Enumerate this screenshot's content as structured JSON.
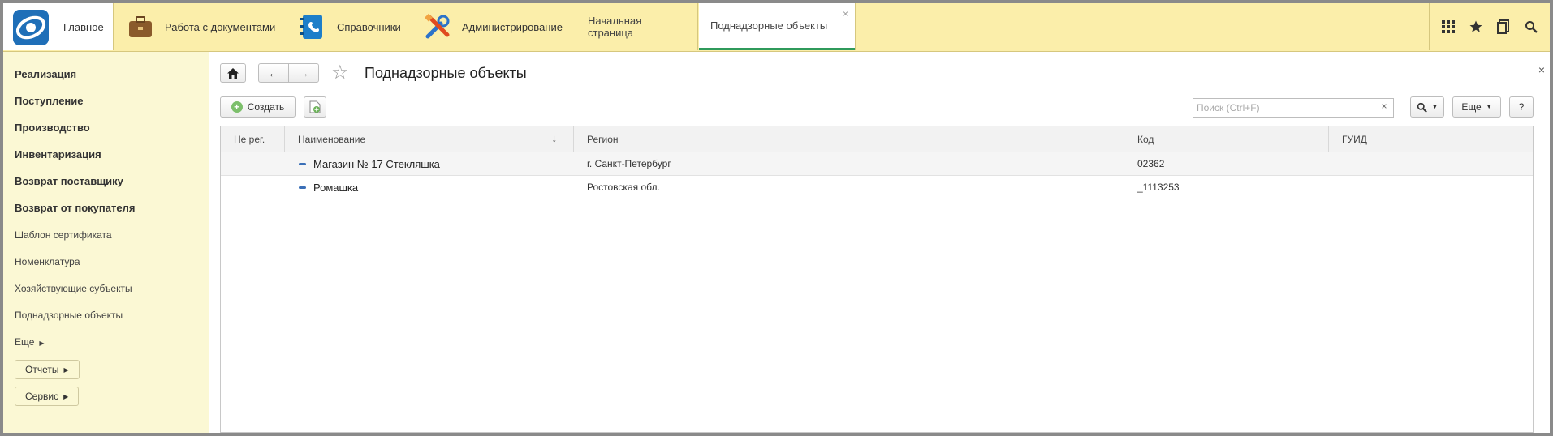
{
  "topbar": {
    "main_label": "Главное",
    "sections": [
      {
        "label": "Работа с документами",
        "icon": "briefcase-icon"
      },
      {
        "label": "Справочники",
        "icon": "address-book-icon"
      },
      {
        "label": "Администрирование",
        "icon": "tools-icon"
      }
    ],
    "tabs": [
      {
        "label": "Начальная страница"
      },
      {
        "label": "Поднадзорные объекты",
        "active": true,
        "close": "×"
      }
    ],
    "tools": [
      "apps-grid-icon",
      "favorites-star-icon",
      "history-icon",
      "search-icon"
    ]
  },
  "sidebar": {
    "items_bold": [
      "Реализация",
      "Поступление",
      "Производство",
      "Инвентаризация",
      "Возврат поставщику",
      "Возврат от покупателя"
    ],
    "items": [
      "Шаблон сертификата",
      "Номенклатура",
      "Хозяйствующие субъекты",
      "Поднадзорные объекты"
    ],
    "more_label": "Еще",
    "buttons": [
      "Отчеты",
      "Сервис"
    ]
  },
  "form": {
    "title": "Поднадзорные объекты",
    "close": "×",
    "create_label": "Создать",
    "search_placeholder": "Поиск (Ctrl+F)",
    "search_clear": "×",
    "more_label": "Еще",
    "help_label": "?",
    "columns": [
      "Не рег.",
      "Наименование",
      "Регион",
      "Код",
      "ГУИД"
    ],
    "sort_arrow": "↓",
    "rows": [
      {
        "not_reg": "",
        "name": "Магазин № 17 Стекляшка",
        "region": "г. Санкт-Петербург",
        "code": "02362",
        "guid": ""
      },
      {
        "not_reg": "",
        "name": "Ромашка",
        "region": "Ростовская обл.",
        "code": "_1113253",
        "guid": ""
      }
    ]
  },
  "colors": {
    "topbar_bg": "#fbeeaa",
    "sidebar_bg": "#fbf8d4",
    "active_tab_underline": "#2f9a5b",
    "row_marker": "#3a6fb7"
  }
}
